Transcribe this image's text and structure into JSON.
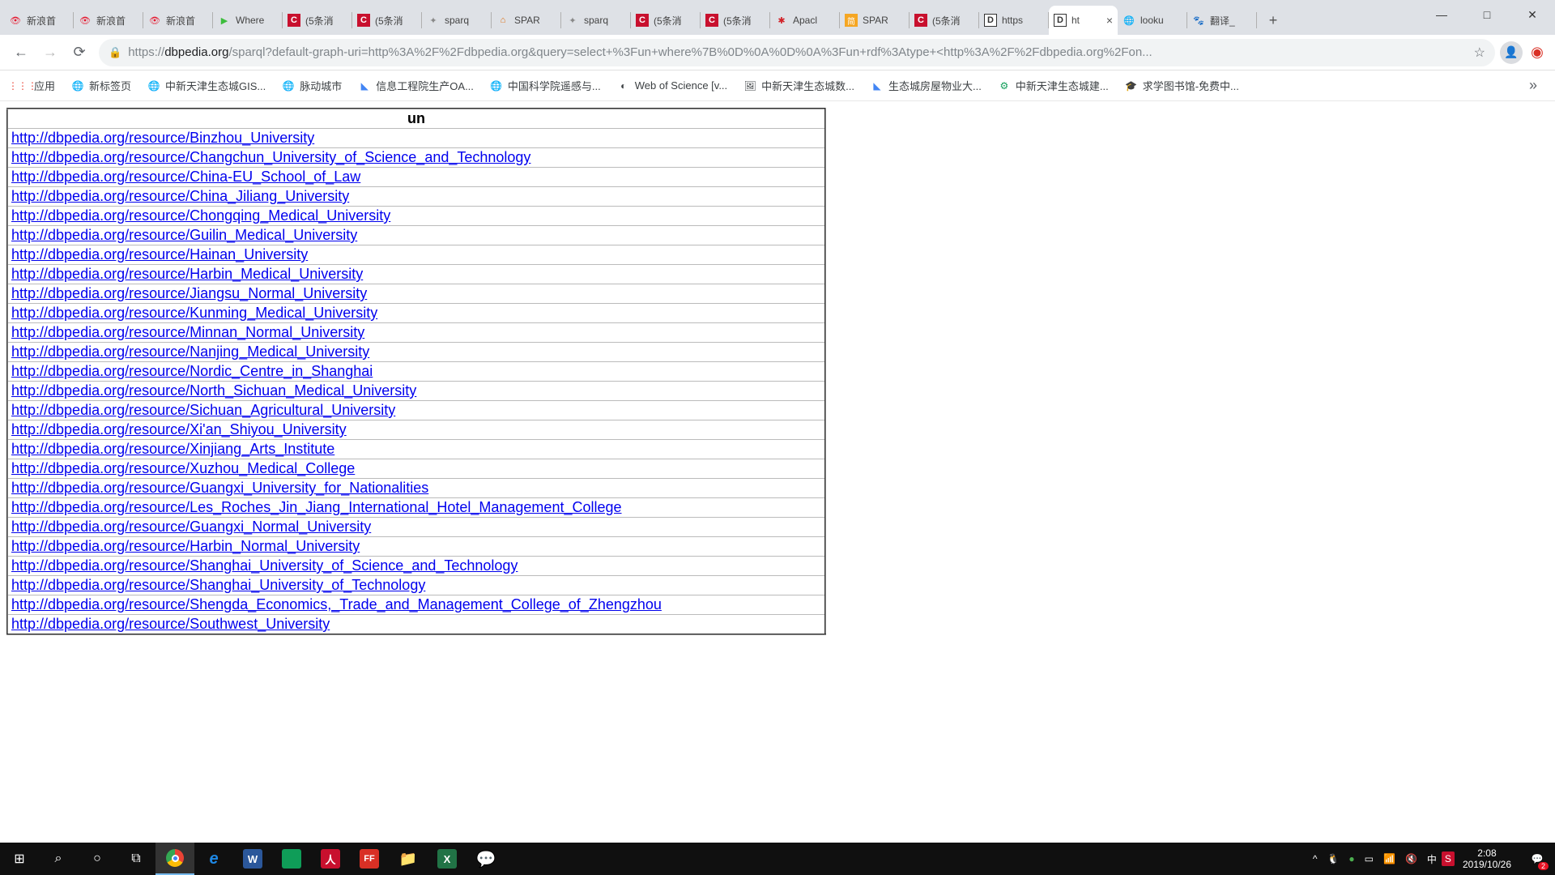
{
  "tabs": [
    {
      "title": "新浪首",
      "favicon": "weibo"
    },
    {
      "title": "新浪首",
      "favicon": "weibo"
    },
    {
      "title": "新浪首",
      "favicon": "weibo"
    },
    {
      "title": "Where",
      "favicon": "green"
    },
    {
      "title": "(5条消",
      "favicon": "red-c"
    },
    {
      "title": "(5条消",
      "favicon": "red-c"
    },
    {
      "title": "sparq",
      "favicon": "gray"
    },
    {
      "title": "SPAR",
      "favicon": "orange"
    },
    {
      "title": "sparq",
      "favicon": "gray"
    },
    {
      "title": "(5条消",
      "favicon": "red-c"
    },
    {
      "title": "(5条消",
      "favicon": "red-c"
    },
    {
      "title": "Apacl",
      "favicon": "feather"
    },
    {
      "title": "SPAR",
      "favicon": "orange-s"
    },
    {
      "title": "(5条消",
      "favicon": "red-c"
    },
    {
      "title": "https",
      "favicon": "d"
    },
    {
      "title": "ht",
      "favicon": "d",
      "active": true,
      "close": true
    },
    {
      "title": "looku",
      "favicon": "globe"
    },
    {
      "title": "翻译_",
      "favicon": "baidu"
    }
  ],
  "url": {
    "scheme": "https://",
    "host": "dbpedia.org",
    "path": "/sparql?default-graph-uri=http%3A%2F%2Fdbpedia.org&query=select+%3Fun+where%7B%0D%0A%0D%0A%3Fun+rdf%3Atype+<http%3A%2F%2Fdbpedia.org%2Fon..."
  },
  "bookmarks": [
    {
      "label": "应用",
      "icon": "apps"
    },
    {
      "label": "新标签页",
      "icon": "globe"
    },
    {
      "label": "中新天津生态城GIS...",
      "icon": "globe"
    },
    {
      "label": "脉动城市",
      "icon": "globe"
    },
    {
      "label": "信息工程院生产OA...",
      "icon": "wps"
    },
    {
      "label": "中国科学院遥感与...",
      "icon": "globe"
    },
    {
      "label": "Web of Science [v...",
      "icon": "wos"
    },
    {
      "label": "中新天津生态城数...",
      "icon": "img"
    },
    {
      "label": "生态城房屋物业大...",
      "icon": "wps"
    },
    {
      "label": "中新天津生态城建...",
      "icon": "gear"
    },
    {
      "label": "求学图书馆-免费中...",
      "icon": "edu"
    }
  ],
  "table": {
    "header": "un",
    "rows": [
      "http://dbpedia.org/resource/Binzhou_University",
      "http://dbpedia.org/resource/Changchun_University_of_Science_and_Technology",
      "http://dbpedia.org/resource/China-EU_School_of_Law",
      "http://dbpedia.org/resource/China_Jiliang_University",
      "http://dbpedia.org/resource/Chongqing_Medical_University",
      "http://dbpedia.org/resource/Guilin_Medical_University",
      "http://dbpedia.org/resource/Hainan_University",
      "http://dbpedia.org/resource/Harbin_Medical_University",
      "http://dbpedia.org/resource/Jiangsu_Normal_University",
      "http://dbpedia.org/resource/Kunming_Medical_University",
      "http://dbpedia.org/resource/Minnan_Normal_University",
      "http://dbpedia.org/resource/Nanjing_Medical_University",
      "http://dbpedia.org/resource/Nordic_Centre_in_Shanghai",
      "http://dbpedia.org/resource/North_Sichuan_Medical_University",
      "http://dbpedia.org/resource/Sichuan_Agricultural_University",
      "http://dbpedia.org/resource/Xi'an_Shiyou_University",
      "http://dbpedia.org/resource/Xinjiang_Arts_Institute",
      "http://dbpedia.org/resource/Xuzhou_Medical_College",
      "http://dbpedia.org/resource/Guangxi_University_for_Nationalities",
      "http://dbpedia.org/resource/Les_Roches_Jin_Jiang_International_Hotel_Management_College",
      "http://dbpedia.org/resource/Guangxi_Normal_University",
      "http://dbpedia.org/resource/Harbin_Normal_University",
      "http://dbpedia.org/resource/Shanghai_University_of_Science_and_Technology",
      "http://dbpedia.org/resource/Shanghai_University_of_Technology",
      "http://dbpedia.org/resource/Shengda_Economics,_Trade_and_Management_College_of_Zhengzhou",
      "http://dbpedia.org/resource/Southwest_University"
    ]
  },
  "clock": {
    "time": "2:08",
    "date": "2019/10/26"
  },
  "notif_count": "2"
}
